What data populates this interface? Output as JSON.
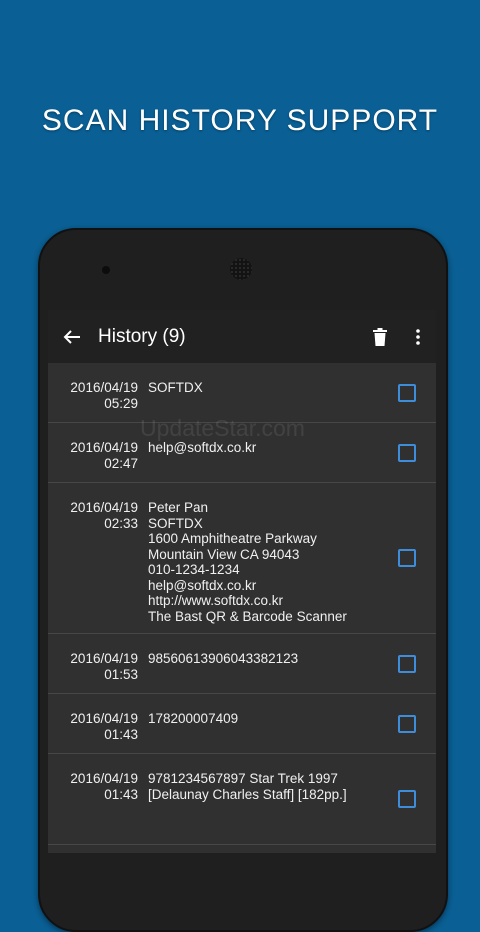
{
  "headline": "SCAN HISTORY SUPPORT",
  "app": {
    "title": "History (9)",
    "back_icon": "arrow-left-icon",
    "delete_icon": "trash-icon",
    "menu_icon": "more-vert-icon"
  },
  "history": [
    {
      "date": "2016/04/19",
      "time": "05:29",
      "text": "SOFTDX",
      "checked": false
    },
    {
      "date": "2016/04/19",
      "time": "02:47",
      "text": "help@softdx.co.kr",
      "checked": false
    },
    {
      "date": "2016/04/19",
      "time": "02:33",
      "text": "Peter Pan\nSOFTDX\n1600 Amphitheatre Parkway\nMountain View CA 94043\n010-1234-1234\nhelp@softdx.co.kr\nhttp://www.softdx.co.kr\nThe Bast QR & Barcode Scanner",
      "checked": false
    },
    {
      "date": "2016/04/19",
      "time": "01:53",
      "text": "98560613906043382123",
      "checked": false
    },
    {
      "date": "2016/04/19",
      "time": "01:43",
      "text": "178200007409",
      "checked": false
    },
    {
      "date": "2016/04/19",
      "time": "01:43",
      "text": "9781234567897 Star Trek 1997\n[Delaunay Charles Staff] [182pp.]",
      "checked": false
    }
  ],
  "watermark": "UpdateStar.com",
  "colors": {
    "background": "#0a5f94",
    "appbar": "#212121",
    "list": "#303030",
    "checkbox": "#3d8ddb"
  }
}
